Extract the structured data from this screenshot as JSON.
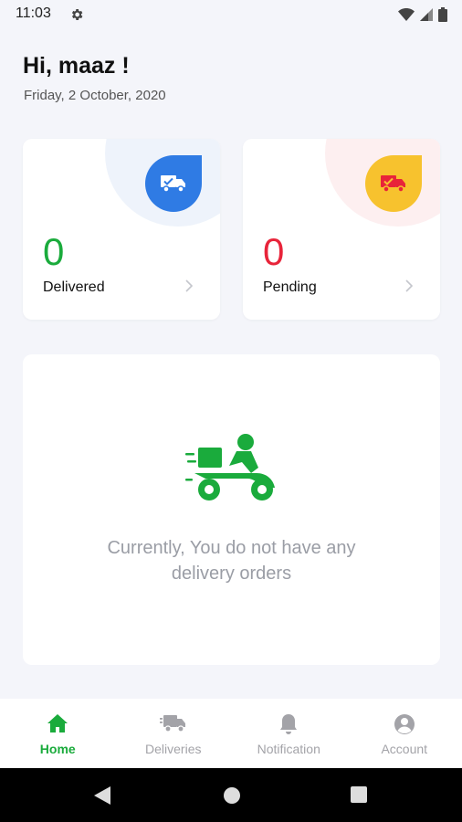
{
  "status_bar": {
    "time": "11:03",
    "icons": [
      "gear-icon",
      "wifi-icon",
      "signal-icon",
      "battery-icon"
    ]
  },
  "header": {
    "greeting": "Hi, maaz !",
    "date": "Friday, 2 October, 2020"
  },
  "stats": [
    {
      "count": "0",
      "label": "Delivered",
      "icon": "delivered-truck-icon",
      "accent": "#2f7be4",
      "count_color": "#1aab3c"
    },
    {
      "count": "0",
      "label": "Pending",
      "icon": "pending-truck-icon",
      "accent": "#f7c22e",
      "count_color": "#e8243a"
    }
  ],
  "empty_state": {
    "icon": "delivery-scooter-icon",
    "line1": "Currently, You do not have any",
    "line2": "delivery orders"
  },
  "bottom_nav": [
    {
      "label": "Home",
      "icon": "home-icon",
      "active": true
    },
    {
      "label": "Deliveries",
      "icon": "truck-icon",
      "active": false
    },
    {
      "label": "Notification",
      "icon": "bell-icon",
      "active": false
    },
    {
      "label": "Account",
      "icon": "account-icon",
      "active": false
    }
  ],
  "colors": {
    "primary_green": "#1aab3c",
    "background": "#f4f5fa"
  }
}
